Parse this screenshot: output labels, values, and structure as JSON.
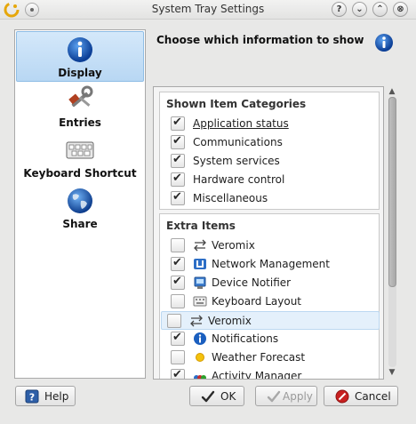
{
  "window": {
    "title": "System Tray Settings",
    "help_btn": "?",
    "minimize_btn": "⌄",
    "maximize_btn": "⌃",
    "close_btn": "⊗"
  },
  "sidebar": {
    "items": [
      {
        "label": "Display",
        "icon": "info-icon",
        "active": true
      },
      {
        "label": "Entries",
        "icon": "tools-icon",
        "active": false
      },
      {
        "label": "Keyboard Shortcut",
        "icon": "keyboard-icon",
        "active": false
      },
      {
        "label": "Share",
        "icon": "globe-icon",
        "active": false
      }
    ]
  },
  "main": {
    "header": "Choose which information to show",
    "categories": {
      "title": "Shown Item Categories",
      "items": [
        {
          "label": "Application status",
          "checked": true
        },
        {
          "label": "Communications",
          "checked": true
        },
        {
          "label": "System services",
          "checked": true
        },
        {
          "label": "Hardware control",
          "checked": true
        },
        {
          "label": "Miscellaneous",
          "checked": true
        }
      ]
    },
    "extra": {
      "title": "Extra Items",
      "items": [
        {
          "label": "Veromix",
          "checked": false,
          "icon": "sliders-icon"
        },
        {
          "label": "Network Management",
          "checked": true,
          "icon": "network-icon"
        },
        {
          "label": "Device Notifier",
          "checked": true,
          "icon": "device-notifier-icon"
        },
        {
          "label": "Keyboard Layout",
          "checked": false,
          "icon": "keyboard-layout-icon"
        },
        {
          "label": "Veromix",
          "checked": false,
          "icon": "sliders-icon"
        },
        {
          "label": "Notifications",
          "checked": true,
          "icon": "info-icon"
        },
        {
          "label": "Weather Forecast",
          "checked": false,
          "icon": "weather-icon"
        },
        {
          "label": "Activity Manager",
          "checked": true,
          "icon": "activity-icon"
        }
      ]
    }
  },
  "buttons": {
    "help": "Help",
    "ok": "OK",
    "apply": "Apply",
    "cancel": "Cancel"
  },
  "colors": {
    "accent": "#b8d7f3",
    "info_blue": "#1b5fbf",
    "cancel_red": "#c82020"
  }
}
